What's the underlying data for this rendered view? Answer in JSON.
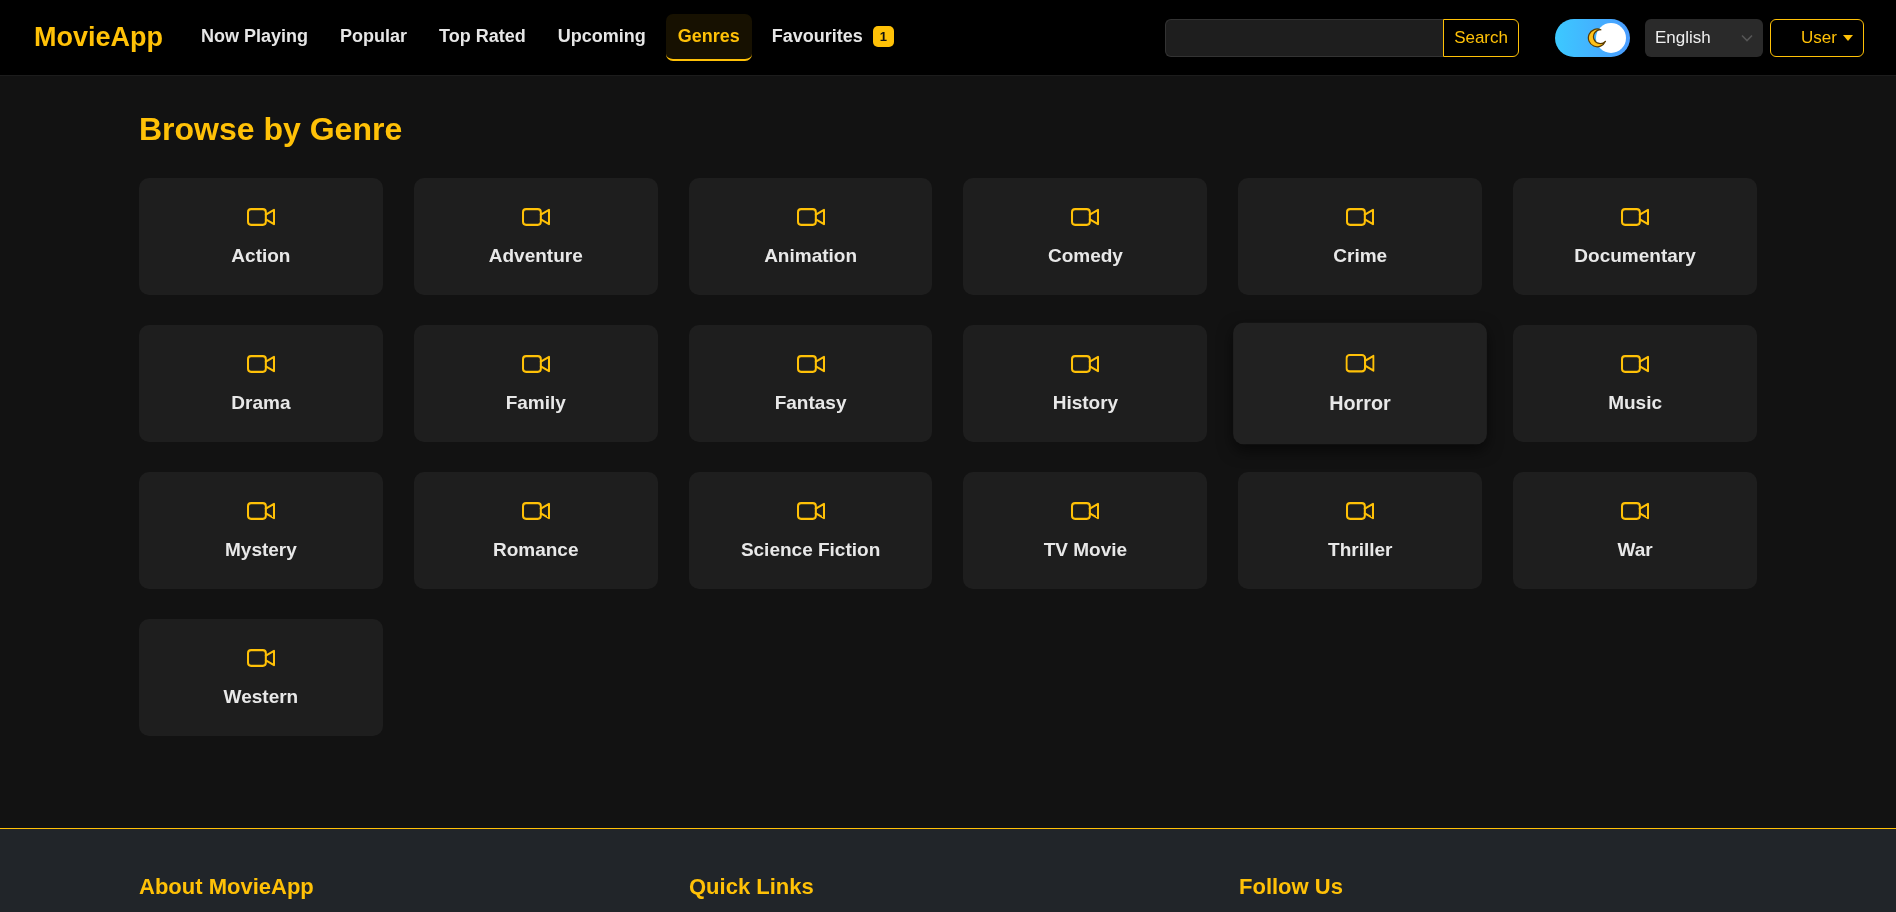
{
  "brand": "MovieApp",
  "nav": [
    {
      "label": "Now Playing",
      "selected": false
    },
    {
      "label": "Popular",
      "selected": false
    },
    {
      "label": "Top Rated",
      "selected": false
    },
    {
      "label": "Upcoming",
      "selected": false
    },
    {
      "label": "Genres",
      "selected": true
    },
    {
      "label": "Favourites",
      "selected": false,
      "badge": "1"
    }
  ],
  "search": {
    "button": "Search"
  },
  "theme_toggle": {
    "on": true
  },
  "language": {
    "value": "English"
  },
  "user_menu": {
    "label": "User"
  },
  "page_title": "Browse by Genre",
  "genres": [
    {
      "name": "Action",
      "hovered": false
    },
    {
      "name": "Adventure",
      "hovered": false
    },
    {
      "name": "Animation",
      "hovered": false
    },
    {
      "name": "Comedy",
      "hovered": false
    },
    {
      "name": "Crime",
      "hovered": false
    },
    {
      "name": "Documentary",
      "hovered": false
    },
    {
      "name": "Drama",
      "hovered": false
    },
    {
      "name": "Family",
      "hovered": false
    },
    {
      "name": "Fantasy",
      "hovered": false
    },
    {
      "name": "History",
      "hovered": false
    },
    {
      "name": "Horror",
      "hovered": true
    },
    {
      "name": "Music",
      "hovered": false
    },
    {
      "name": "Mystery",
      "hovered": false
    },
    {
      "name": "Romance",
      "hovered": false
    },
    {
      "name": "Science Fiction",
      "hovered": false
    },
    {
      "name": "TV Movie",
      "hovered": false
    },
    {
      "name": "Thriller",
      "hovered": false
    },
    {
      "name": "War",
      "hovered": false
    },
    {
      "name": "Western",
      "hovered": false
    }
  ],
  "footer": {
    "columns": [
      {
        "heading": "About MovieApp"
      },
      {
        "heading": "Quick Links"
      },
      {
        "heading": "Follow Us"
      }
    ]
  }
}
